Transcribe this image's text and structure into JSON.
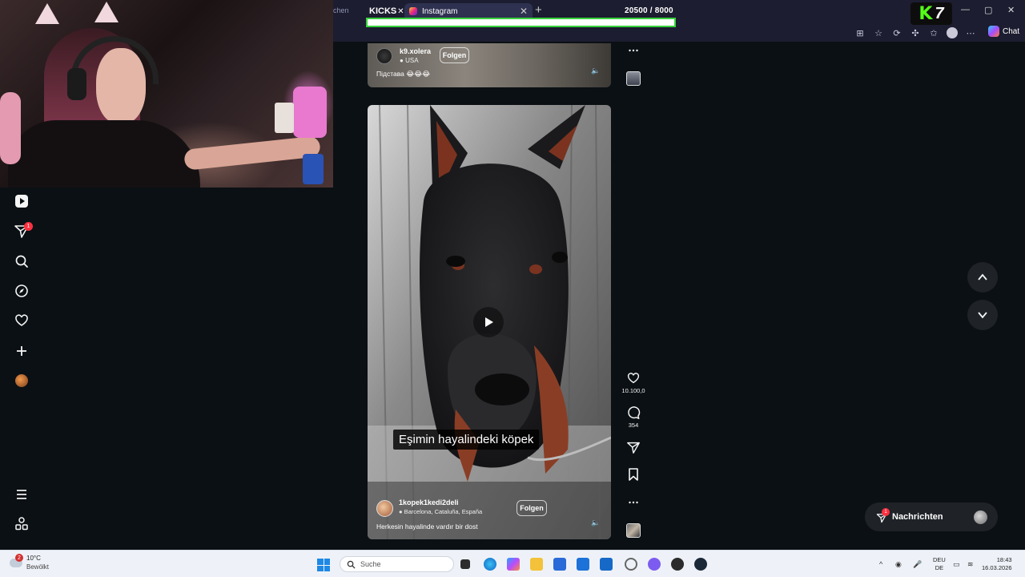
{
  "browser": {
    "faded_tab_text": "chen",
    "tab_kick_label": "KICKS",
    "tab_ig_label": "Instagram",
    "tab_close": "✕",
    "new_tab": "+",
    "counter": "20500  / 8000",
    "progress_fraction": 1.0,
    "chat_label": "Chat"
  },
  "sidebar": {
    "notifications_badge": "1"
  },
  "reel_top": {
    "username": "k9.xolera",
    "location": "USA",
    "follow": "Folgen",
    "caption": "Підстава 😂😂😂"
  },
  "reel_main": {
    "subtitle": "Eşimin hayalindeki köpek",
    "username": "1kopek1kedi2deli",
    "location": "Barcelona, Cataluña, España",
    "follow": "Folgen",
    "caption": "Herkesin hayalinde vardır bir dost",
    "likes": "10.100,0",
    "comments": "354"
  },
  "messages": {
    "label": "Nachrichten",
    "badge": "1"
  },
  "taskbar": {
    "weather_temp": "10°C",
    "weather_desc": "Bewölkt",
    "weather_badge": "2",
    "search_placeholder": "Suche",
    "lang_1": "DEU",
    "lang_2": "DE",
    "time": "18:43",
    "date": "16.03.2026"
  },
  "colors": {
    "kick_green": "#53fc18",
    "progress_border": "#38d23c",
    "ig_badge": "#ff3040",
    "page_bg": "#0b1014"
  }
}
